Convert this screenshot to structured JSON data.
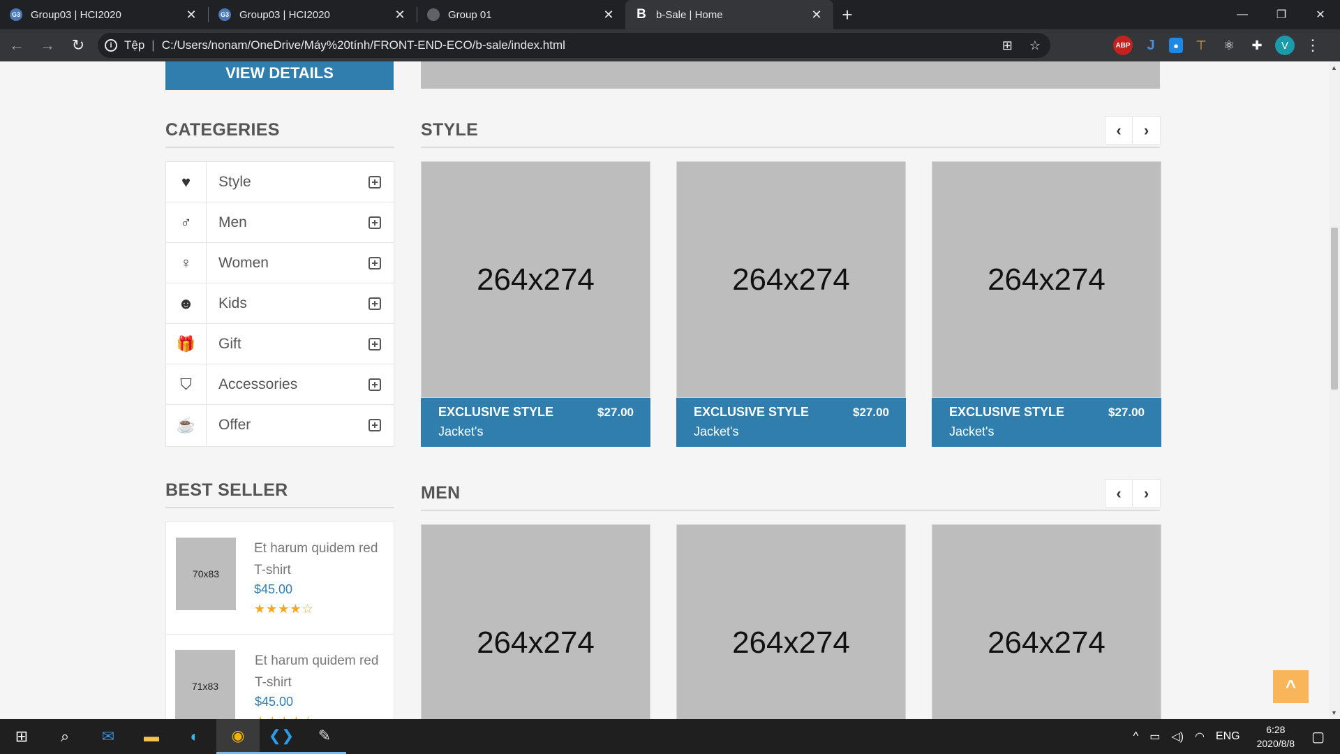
{
  "browser": {
    "tabs": [
      {
        "title": "Group03 | HCI2020",
        "favicon": "G3",
        "active": false
      },
      {
        "title": "Group03 | HCI2020",
        "favicon": "G3",
        "active": false
      },
      {
        "title": "Group 01",
        "favicon": "globe",
        "active": false
      },
      {
        "title": "b-Sale | Home",
        "favicon": "B",
        "active": true
      }
    ],
    "new_tab": "+",
    "address_prefix": "Tệp",
    "address": "C:/Users/nonam/OneDrive/Máy%20tính/FRONT-END-ECO/b-sale/index.html",
    "profile_initial": "V",
    "abp_label": "ABP"
  },
  "page": {
    "view_details": "VIEW DETAILS",
    "categories_title": "CATEGERIES",
    "categories": [
      {
        "icon": "heart-icon",
        "glyph": "♥",
        "label": "Style"
      },
      {
        "icon": "man-icon",
        "glyph": "♂",
        "label": "Men"
      },
      {
        "icon": "woman-icon",
        "glyph": "♀",
        "label": "Women"
      },
      {
        "icon": "kids-icon",
        "glyph": "☻",
        "label": "Kids"
      },
      {
        "icon": "gift-icon",
        "glyph": "🎁",
        "label": "Gift"
      },
      {
        "icon": "bucket-icon",
        "glyph": "⛉",
        "label": "Accessories"
      },
      {
        "icon": "cup-icon",
        "glyph": "☕",
        "label": "Offer"
      }
    ],
    "best_seller_title": "BEST SELLER",
    "best_sellers": [
      {
        "thumb": "70x83",
        "name": "Et harum quidem red T-shirt",
        "price": "$45.00",
        "stars": "★★★★☆"
      },
      {
        "thumb": "71x83",
        "name": "Et harum quidem red T-shirt",
        "price": "$45.00",
        "stars": "★★★★☆"
      }
    ],
    "style_title": "STYLE",
    "men_title": "MEN",
    "style_cards": [
      {
        "image": "264x274",
        "name": "EXCLUSIVE STYLE",
        "sub": "Jacket's",
        "price": "$27.00"
      },
      {
        "image": "264x274",
        "name": "EXCLUSIVE STYLE",
        "sub": "Jacket's",
        "price": "$27.00"
      },
      {
        "image": "264x274",
        "name": "EXCLUSIVE STYLE",
        "sub": "Jacket's",
        "price": "$27.00"
      }
    ],
    "men_cards": [
      {
        "image": "264x274"
      },
      {
        "image": "264x274"
      },
      {
        "image": "264x274"
      }
    ],
    "prev_arrow": "‹",
    "next_arrow": "›",
    "back_to_top": "^"
  },
  "taskbar": {
    "language": "ENG",
    "time": "6:28",
    "date": "2020/8/8"
  },
  "colors": {
    "accent": "#2f7eae",
    "back_to_top": "#f8b55a",
    "placeholder": "#bdbdbd"
  }
}
